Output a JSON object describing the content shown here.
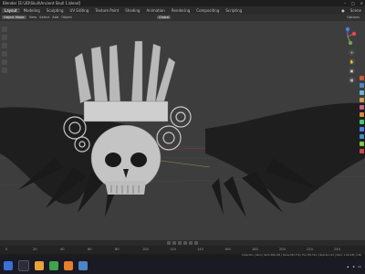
{
  "titlebar": {
    "title": "Blender [E:\\3D\\Skull\\Ancient Skull 1.blend]"
  },
  "menubar": {
    "workspaces": [
      "Layout",
      "Modeling",
      "Sculpting",
      "UV Editing",
      "Texture Paint",
      "Shading",
      "Animation",
      "Rendering",
      "Compositing",
      "Scripting"
    ],
    "active_workspace": "Layout",
    "scene_label": "Scene"
  },
  "toolhdr": {
    "mode": "Object Mode",
    "view": "View",
    "select": "Select",
    "add": "Add",
    "object": "Object",
    "transform": "Global",
    "options": "Options"
  },
  "timeline": {
    "ticks": [
      "0",
      "20",
      "40",
      "60",
      "80",
      "100",
      "120",
      "140",
      "160",
      "180",
      "200",
      "220",
      "240"
    ]
  },
  "statusbar": {
    "text": "Collection | Skull | Verts:384,248 | Faces:382,776 | Tris:765,532 | Objects:1/12 | Mem: 1.06 GiB | 2.90"
  },
  "colors": {
    "accent": "#4772b3",
    "viewport_bg": "#3d3d3d",
    "wing": "#1f1f1f"
  }
}
